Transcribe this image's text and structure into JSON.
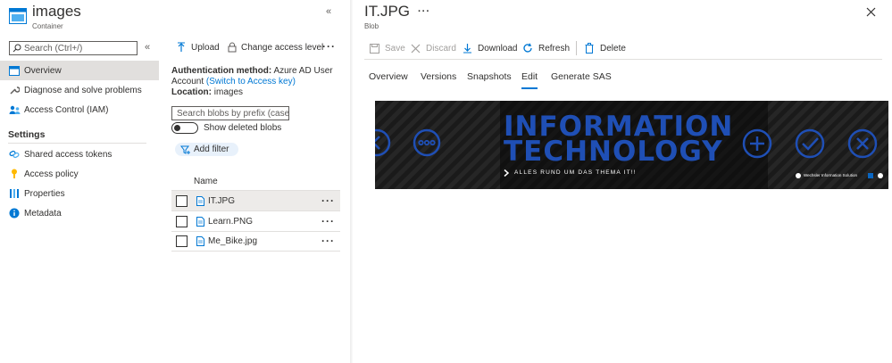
{
  "container": {
    "name": "images",
    "type": "Container"
  },
  "search": {
    "placeholder": "Search (Ctrl+/)"
  },
  "nav": {
    "items": [
      {
        "label": "Overview"
      },
      {
        "label": "Diagnose and solve problems"
      },
      {
        "label": "Access Control (IAM)"
      }
    ],
    "settings_header": "Settings",
    "settings_items": [
      {
        "label": "Shared access tokens"
      },
      {
        "label": "Access policy"
      },
      {
        "label": "Properties"
      },
      {
        "label": "Metadata"
      }
    ]
  },
  "mid": {
    "upload_label": "Upload",
    "change_access_label": "Change access level",
    "auth_method_label": "Authentication method:",
    "auth_method_value": "Azure AD User",
    "account_word": "Account",
    "switch_link": "(Switch to Access key)",
    "location_label": "Location:",
    "location_value": "images",
    "blob_search_placeholder": "Search blobs by prefix (case...",
    "show_deleted_label": "Show deleted blobs",
    "add_filter_label": "Add filter",
    "column_name": "Name",
    "files": [
      {
        "name": "IT.JPG"
      },
      {
        "name": "Learn.PNG"
      },
      {
        "name": "Me_Bike.jpg"
      }
    ]
  },
  "blob": {
    "title": "IT.JPG",
    "type": "Blob",
    "toolbar": {
      "save": "Save",
      "discard": "Discard",
      "download": "Download",
      "refresh": "Refresh",
      "delete": "Delete"
    },
    "tabs": [
      {
        "label": "Overview"
      },
      {
        "label": "Versions"
      },
      {
        "label": "Snapshots"
      },
      {
        "label": "Edit"
      },
      {
        "label": "Generate SAS"
      }
    ]
  },
  "banner": {
    "line1": "INFORMATION",
    "line2": "TECHNOLOGY",
    "tagline": "ALLES RUND UM DAS THEMA IT!!",
    "footer": "Wechsler Information Solution"
  },
  "colors": {
    "accent": "#0078d4",
    "banner_blue": "#1f4fb5",
    "banner_bg": "#111111"
  }
}
